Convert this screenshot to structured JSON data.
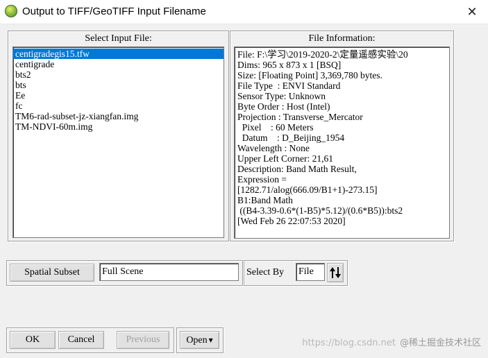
{
  "window": {
    "title": "Output to TIFF/GeoTIFF Input Filename",
    "close_glyph": "✕"
  },
  "select_input": {
    "label": "Select Input File:",
    "files": [
      "centigradegis15.tfw",
      "centigrade",
      "bts2",
      "bts",
      "Ee",
      "fc",
      "TM6-rad-subset-jz-xiangfan.img",
      "TM-NDVI-60m.img"
    ],
    "selected_index": 0
  },
  "file_info": {
    "label": "File Information:",
    "lines": [
      "File: F:\\学习\\2019-2020-2\\定量遥感实验\\20",
      "Dims: 965 x 873 x 1 [BSQ]",
      "Size: [Floating Point] 3,369,780 bytes.",
      "File Type  : ENVI Standard",
      "Sensor Type: Unknown",
      "Byte Order : Host (Intel)",
      "Projection : Transverse_Mercator",
      "  Pixel    : 60 Meters",
      "  Datum    : D_Beijing_1954",
      "Wavelength : None",
      "Upper Left Corner: 21,61",
      "Description: Band Math Result,",
      "Expression =",
      "[1282.71/alog(666.09/B1+1)-273.15]",
      "B1:Band Math",
      " ((B4-3.39-0.6*(1-B5)*5.12)/(0.6*B5)):bts2",
      "[Wed Feb 26 22:07:53 2020]"
    ]
  },
  "subset": {
    "spatial_subset_label": "Spatial Subset",
    "spatial_subset_value": "Full Scene",
    "select_by_label": "Select By",
    "select_by_value": "File",
    "sort_icon": "up-down-arrows-icon"
  },
  "buttons": {
    "ok": "OK",
    "cancel": "Cancel",
    "previous": "Previous",
    "open": "Open",
    "open_arrow": "▾"
  },
  "watermark": {
    "url": "https://blog.csdn.net",
    "text": "@稀土掘金技术社区"
  },
  "colors": {
    "selection": "#0078d7",
    "window_bg": "#f0f0f0"
  }
}
